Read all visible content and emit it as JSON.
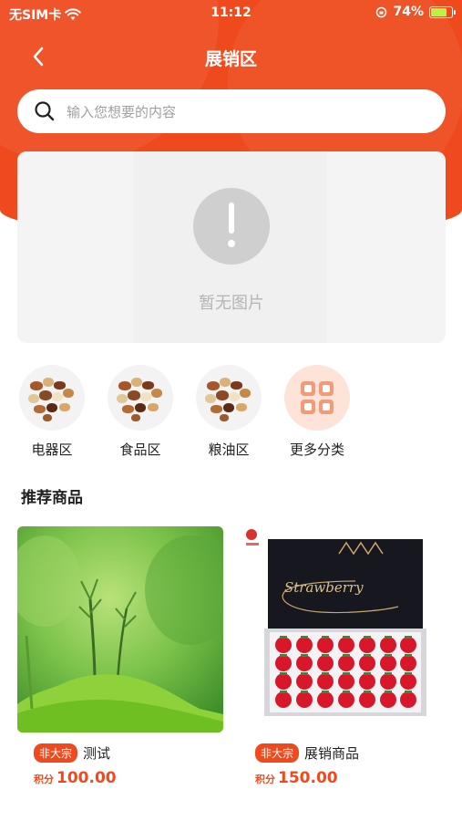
{
  "status_bar": {
    "carrier": "无SIM卡",
    "time": "11:12",
    "battery": "74%"
  },
  "nav": {
    "title": "展销区"
  },
  "search": {
    "placeholder": "输入您想要的内容"
  },
  "banner": {
    "empty_caption": "暂无图片"
  },
  "categories": [
    {
      "label": "电器区",
      "icon": "mixed-nuts-image"
    },
    {
      "label": "食品区",
      "icon": "mixed-nuts-image"
    },
    {
      "label": "粮油区",
      "icon": "mixed-nuts-image"
    },
    {
      "label": "更多分类",
      "icon": "grid-icon"
    }
  ],
  "recommend": {
    "title": "推荐商品"
  },
  "products": [
    {
      "tag": "非大宗",
      "name": "测试",
      "price_unit": "积分",
      "price": "100.00",
      "image": "green-moss-photo"
    },
    {
      "tag": "非大宗",
      "name": "展销商品",
      "price_unit": "积分",
      "price": "150.00",
      "image": "strawberry-box-photo",
      "box_text": "Strawberry"
    }
  ],
  "colors": {
    "accent": "#ef4a1d",
    "background": "#ffffff"
  }
}
